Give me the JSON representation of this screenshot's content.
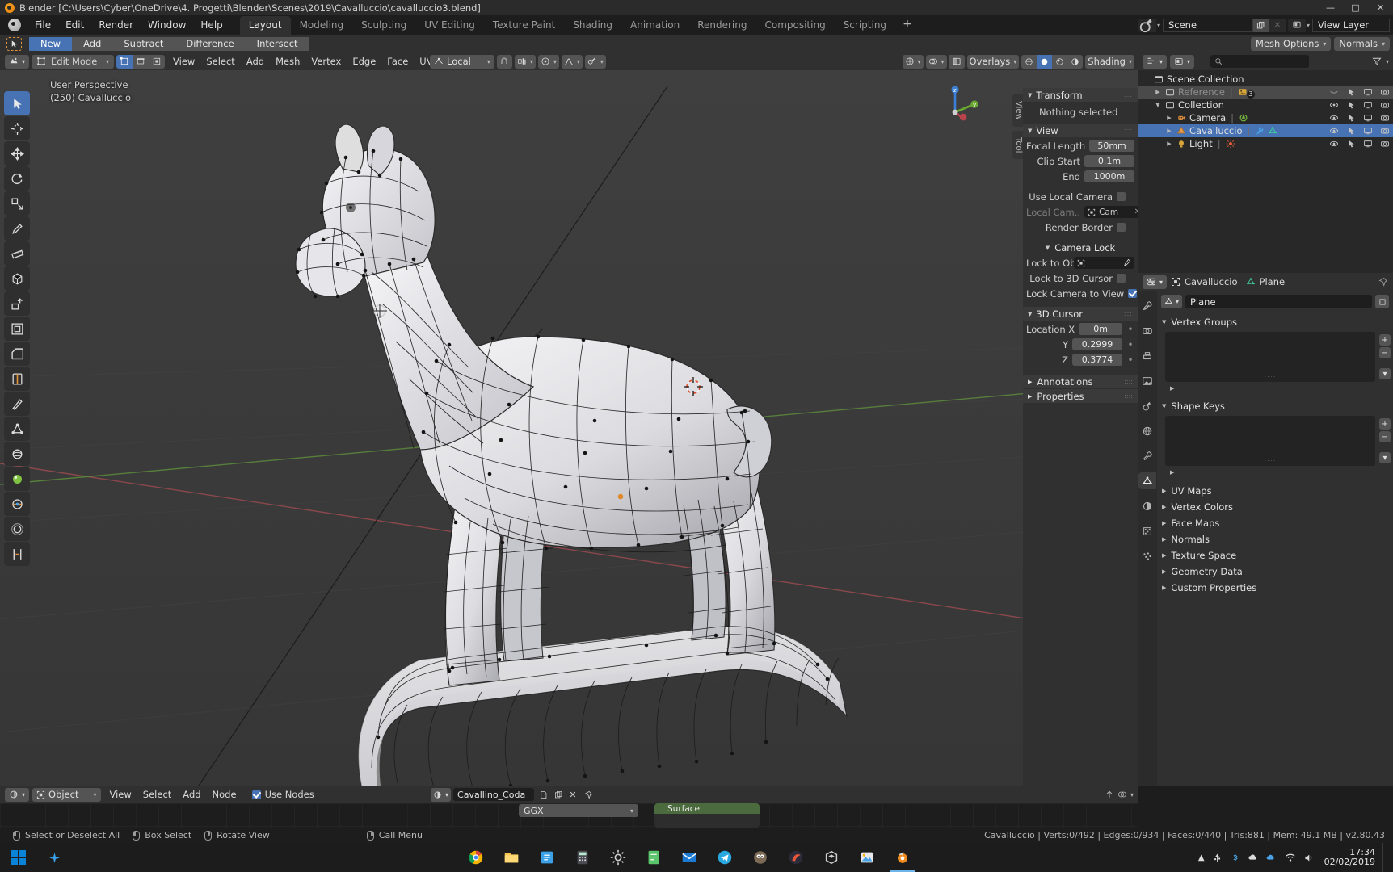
{
  "window": {
    "title": "Blender [C:\\Users\\Cyber\\OneDrive\\4. Progetti\\Blender\\Scenes\\2019\\Cavalluccio\\cavalluccio3.blend]",
    "minimize": "—",
    "maximize": "□",
    "close": "✕"
  },
  "topbar": {
    "menus": [
      "File",
      "Edit",
      "Render",
      "Window",
      "Help"
    ],
    "workspaces": [
      "Layout",
      "Modeling",
      "Sculpting",
      "UV Editing",
      "Texture Paint",
      "Shading",
      "Animation",
      "Rendering",
      "Compositing",
      "Scripting"
    ],
    "active_workspace": "Layout",
    "add_workspace": "+",
    "scene_name": "Scene",
    "view_layer_name": "View Layer",
    "new_scene_icon": "copy-icon",
    "remove_scene_icon": "x-icon"
  },
  "optbar": {
    "boolean_ops": [
      "New",
      "Add",
      "Subtract",
      "Difference",
      "Intersect"
    ],
    "active_op": "New",
    "mesh_options": "Mesh Options",
    "normals": "Normals"
  },
  "viewport_header": {
    "editor_icon": "editor-type-icon",
    "mode": "Edit Mode",
    "select_modes": [
      "vertex-select-icon",
      "edge-select-icon",
      "face-select-icon"
    ],
    "active_select_mode": "vertex-select-icon",
    "menus": [
      "View",
      "Select",
      "Add",
      "Mesh",
      "Vertex",
      "Edge",
      "Face",
      "UV"
    ],
    "orientation": "Local",
    "snap_icon": "magnet-icon",
    "snap_target": "snap-increment-icon",
    "proportional_icon": "proportional-editing-icon",
    "falloff_icon": "smooth-falloff-icon",
    "mirror_icon": "mirror-icon",
    "gizmo_icon": "gizmo-icon",
    "overlays_label": "Overlays",
    "shading_label": "Shading",
    "xray_icon": "xray-icon"
  },
  "viewport": {
    "perspective_line1": "User Perspective",
    "perspective_line2": "(250) Cavalluccio",
    "gizmo_axes": [
      "z",
      "y",
      "x"
    ]
  },
  "toolbar": {
    "tools": [
      {
        "name": "tweak-tool",
        "icon": "cursor-arrow-icon",
        "active": true
      },
      {
        "name": "cursor-tool",
        "icon": "3d-cursor-icon",
        "active": false
      },
      {
        "name": "move-tool",
        "icon": "move-icon",
        "active": false
      },
      {
        "name": "rotate-tool",
        "icon": "rotate-icon",
        "active": false
      },
      {
        "name": "scale-tool",
        "icon": "scale-icon",
        "active": false
      },
      {
        "name": "annotate-tool",
        "icon": "pencil-icon",
        "active": false
      },
      {
        "name": "measure-tool",
        "icon": "ruler-icon",
        "active": false
      },
      {
        "name": "add-cube-tool",
        "icon": "add-cube-icon",
        "active": false
      },
      {
        "name": "extrude-region-tool",
        "icon": "extrude-icon",
        "active": false
      },
      {
        "name": "inset-faces-tool",
        "icon": "inset-icon",
        "active": false
      },
      {
        "name": "bevel-tool",
        "icon": "bevel-icon",
        "active": false
      },
      {
        "name": "loop-cut-tool",
        "icon": "loop-cut-icon",
        "active": false
      },
      {
        "name": "knife-tool",
        "icon": "knife-icon",
        "active": false
      },
      {
        "name": "poly-build-tool",
        "icon": "poly-build-icon",
        "active": false
      },
      {
        "name": "spin-tool",
        "icon": "spin-icon",
        "active": false
      },
      {
        "name": "smooth-tool",
        "icon": "smooth-icon",
        "active": false
      },
      {
        "name": "edge-slide-tool",
        "icon": "edge-slide-icon",
        "active": false
      },
      {
        "name": "shrink-fatten-tool",
        "icon": "shrink-fatten-icon",
        "active": false
      },
      {
        "name": "rip-region-tool",
        "icon": "rip-region-icon",
        "active": false
      }
    ]
  },
  "sidetabs": [
    "View",
    "Tool"
  ],
  "npanel": {
    "transform": {
      "title": "Transform",
      "message": "Nothing selected"
    },
    "view": {
      "title": "View",
      "focal_length_label": "Focal Length",
      "focal_length_value": "50mm",
      "clip_start_label": "Clip Start",
      "clip_start_value": "0.1m",
      "clip_end_label": "End",
      "clip_end_value": "1000m",
      "use_local_camera_label": "Use Local Camera",
      "use_local_camera_checked": false,
      "local_camera_label": "Local Cam..",
      "local_camera_value": "Cam",
      "render_border_label": "Render Border",
      "render_border_checked": false
    },
    "camera_lock": {
      "title": "Camera Lock",
      "lock_to_object_label": "Lock to Obj..",
      "lock_to_object_value": "",
      "lock_to_3d_cursor_label": "Lock to 3D Cursor",
      "lock_to_3d_cursor_checked": false,
      "lock_camera_to_view_label": "Lock Camera to View",
      "lock_camera_to_view_checked": true
    },
    "cursor3d": {
      "title": "3D Cursor",
      "rows": [
        {
          "label": "Location X",
          "value": "0m"
        },
        {
          "label": "Y",
          "value": "0.2999"
        },
        {
          "label": "Z",
          "value": "0.3774"
        }
      ]
    },
    "collapsed": [
      "Annotations",
      "Properties"
    ]
  },
  "outliner": {
    "editor_icon": "outliner-icon",
    "display_mode_icon": "view-layer-icon",
    "search_placeholder": "",
    "filter_icon": "filter-icon",
    "rows": [
      {
        "name": "Scene Collection",
        "indent": 0,
        "tri": "",
        "icon": "collection-icon",
        "selected": false,
        "greyed": false,
        "badge": "",
        "extra_icons": [],
        "show_eye": false,
        "visibility": []
      },
      {
        "name": "Reference",
        "indent": 1,
        "tri": "▶",
        "icon": "collection-icon",
        "selected": false,
        "greyed": true,
        "badge": "3",
        "extra_icons": [
          "image-icon"
        ],
        "show_eye": true,
        "visibility": [
          "closed-eye-icon",
          "arrow-icon",
          "monitor-icon",
          "camera-icon"
        ]
      },
      {
        "name": "Collection",
        "indent": 1,
        "tri": "▼",
        "icon": "collection-icon",
        "selected": false,
        "greyed": false,
        "badge": "",
        "extra_icons": [],
        "show_eye": true,
        "visibility": [
          "eye-icon",
          "arrow-icon",
          "monitor-icon",
          "camera-icon"
        ]
      },
      {
        "name": "Camera",
        "indent": 2,
        "tri": "▶",
        "icon": "camera-object-icon",
        "selected": false,
        "greyed": false,
        "badge": "",
        "extra_icons": [
          "camera-data-icon"
        ],
        "show_eye": true,
        "visibility": [
          "eye-icon",
          "arrow-icon",
          "monitor-icon",
          "camera-icon"
        ]
      },
      {
        "name": "Cavalluccio",
        "indent": 2,
        "tri": "▶",
        "icon": "mesh-object-icon",
        "selected": true,
        "greyed": false,
        "badge": "",
        "extra_icons": [
          "modifier-icon",
          "mesh-data-icon"
        ],
        "show_eye": true,
        "visibility": [
          "eye-icon",
          "arrow-icon",
          "monitor-icon",
          "camera-icon"
        ]
      },
      {
        "name": "Light",
        "indent": 2,
        "tri": "▶",
        "icon": "light-object-icon",
        "selected": false,
        "greyed": false,
        "badge": "",
        "extra_icons": [
          "light-data-icon"
        ],
        "show_eye": true,
        "visibility": [
          "eye-icon",
          "arrow-icon",
          "monitor-icon",
          "camera-icon"
        ]
      }
    ]
  },
  "properties": {
    "editor_icon": "properties-icon",
    "breadcrumb": [
      {
        "icon": "object-icon",
        "label": "Cavalluccio"
      },
      {
        "icon": "mesh-data-icon",
        "label": "Plane"
      }
    ],
    "data_name_icon": "mesh-data-icon",
    "data_name": "Plane",
    "tabs": [
      {
        "name": "tool-tab",
        "icon": "tool-icon",
        "active": false
      },
      {
        "name": "render-tab",
        "icon": "render-icon",
        "active": false
      },
      {
        "name": "output-tab",
        "icon": "printer-icon",
        "active": false
      },
      {
        "name": "view-layer-tab",
        "icon": "images-icon",
        "active": false
      },
      {
        "name": "scene-tab",
        "icon": "scene-icon",
        "active": false
      },
      {
        "name": "world-tab",
        "icon": "world-icon",
        "active": false
      },
      {
        "name": "modifier-tab",
        "icon": "wrench-icon",
        "active": false
      },
      {
        "name": "object-data-tab",
        "icon": "mesh-data-icon",
        "active": true
      },
      {
        "name": "material-tab",
        "icon": "material-icon",
        "active": false
      },
      {
        "name": "texture-tab",
        "icon": "texture-icon",
        "active": false
      },
      {
        "name": "particles-tab",
        "icon": "particles-icon",
        "active": false
      }
    ],
    "sections": [
      {
        "label": "Vertex Groups",
        "open": true
      },
      {
        "label": "Shape Keys",
        "open": true
      },
      {
        "label": "UV Maps",
        "open": false
      },
      {
        "label": "Vertex Colors",
        "open": false
      },
      {
        "label": "Face Maps",
        "open": false
      },
      {
        "label": "Normals",
        "open": false
      },
      {
        "label": "Texture Space",
        "open": false
      },
      {
        "label": "Geometry Data",
        "open": false
      },
      {
        "label": "Custom Properties",
        "open": false
      }
    ]
  },
  "shader_editor": {
    "editor_icon": "shader-editor-icon",
    "shader_type": "Object",
    "menus": [
      "View",
      "Select",
      "Add",
      "Node"
    ],
    "use_nodes_label": "Use Nodes",
    "use_nodes_checked": true,
    "material_name": "Cavallino_Coda",
    "new_material_icon": "new-icon",
    "copy_material_icon": "copy-icon",
    "unlink_material_icon": "x-icon",
    "pin_icon": "pin-icon",
    "ggx_label": "GGX",
    "node_title": "Surface"
  },
  "statusbar": {
    "hints": [
      {
        "mouse": "left",
        "label": "Select or Deselect All"
      },
      {
        "mouse": "left",
        "label": "Box Select"
      },
      {
        "mouse": "middle",
        "label": "Rotate View"
      },
      {
        "mouse": "right",
        "label": "Call Menu"
      }
    ],
    "stats": "Cavalluccio | Verts:0/492 | Edges:0/934 | Faces:0/440 | Tris:881 | Mem: 49.1 MB | v2.80.43"
  },
  "taskbar": {
    "apps": [
      {
        "name": "chrome-icon"
      },
      {
        "name": "file-explorer-icon"
      },
      {
        "name": "store-icon"
      },
      {
        "name": "calculator-icon"
      },
      {
        "name": "settings-icon"
      },
      {
        "name": "notes-icon"
      },
      {
        "name": "mail-icon"
      },
      {
        "name": "telegram-icon"
      },
      {
        "name": "gimp-icon"
      },
      {
        "name": "krita-icon"
      },
      {
        "name": "unity-icon"
      },
      {
        "name": "photos-icon"
      },
      {
        "name": "blender-icon",
        "active": true
      }
    ],
    "time": "17:34",
    "date": "02/02/2019",
    "tray_icons": [
      "chevron-up-icon",
      "usb-icon",
      "bluetooth-icon",
      "cloud-icon",
      "onedrive-icon",
      "wifi-icon",
      "volume-icon"
    ]
  },
  "colors": {
    "accent": "#4772b3",
    "panel": "#303030",
    "viewport": "#393939",
    "orange": "#e3933a"
  }
}
